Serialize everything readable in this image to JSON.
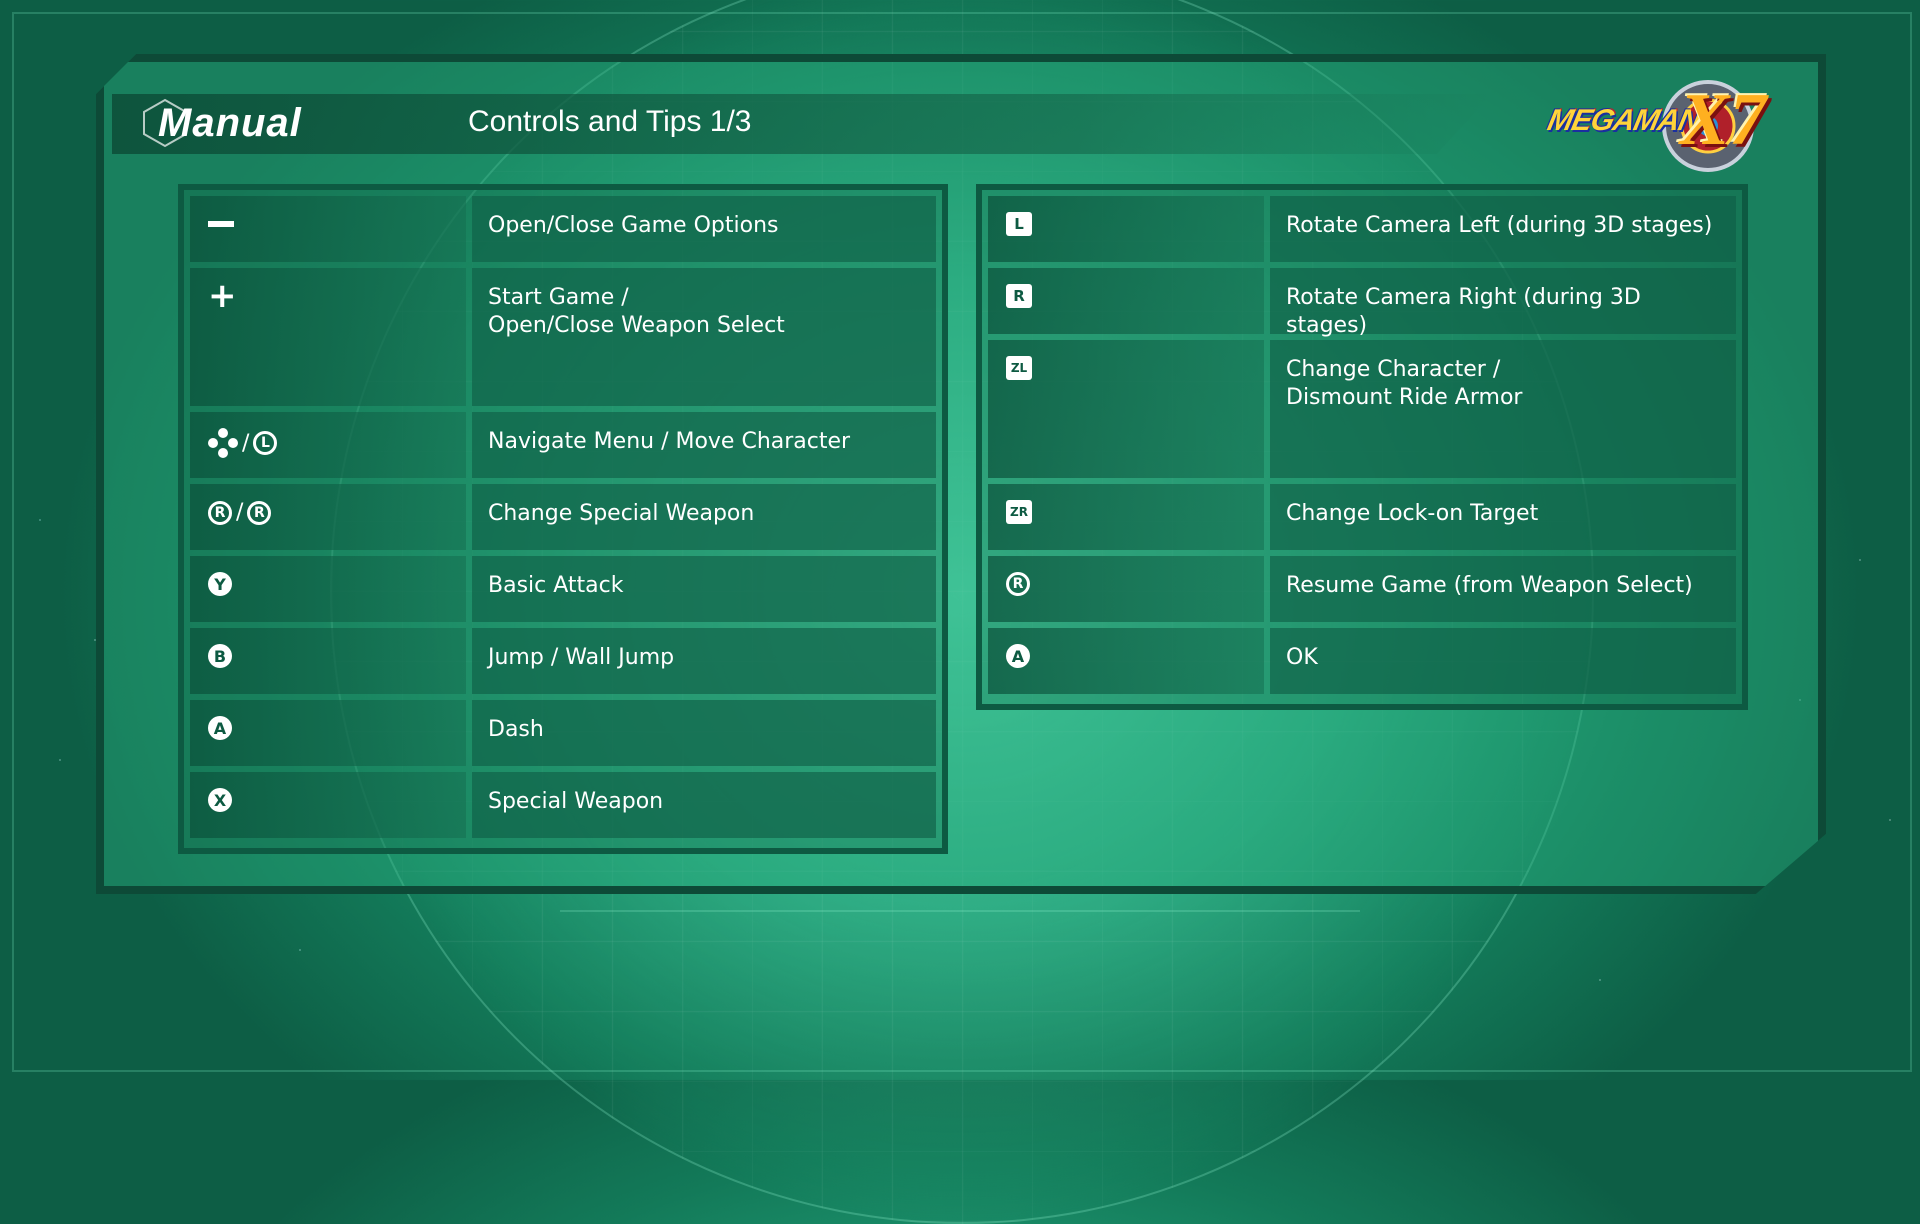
{
  "header": {
    "section_title": "Manual",
    "page_title": "Controls and Tips 1/3",
    "logo_text": "MEGAMAN",
    "logo_number": "X7"
  },
  "left_controls": [
    {
      "icons": [
        "minus-icon"
      ],
      "description": "Open/Close Game Options"
    },
    {
      "icons": [
        "plus-icon"
      ],
      "description": "Start Game /\nOpen/Close Weapon Select"
    },
    {
      "icons": [
        "dpad-icon",
        "left-stick-icon"
      ],
      "icon_labels": [
        "",
        "L"
      ],
      "separator": "/",
      "description": "Navigate Menu / Move Character"
    },
    {
      "icons": [
        "right-stick-left-icon",
        "right-stick-right-icon"
      ],
      "icon_labels": [
        "R",
        "R"
      ],
      "separator": "/",
      "description": "Change Special Weapon"
    },
    {
      "icons": [
        "y-button-icon"
      ],
      "icon_labels": [
        "Y"
      ],
      "description": "Basic Attack"
    },
    {
      "icons": [
        "b-button-icon"
      ],
      "icon_labels": [
        "B"
      ],
      "description": "Jump / Wall Jump"
    },
    {
      "icons": [
        "a-button-icon"
      ],
      "icon_labels": [
        "A"
      ],
      "description": "Dash"
    },
    {
      "icons": [
        "x-button-icon"
      ],
      "icon_labels": [
        "X"
      ],
      "description": "Special Weapon"
    }
  ],
  "right_controls": [
    {
      "icons": [
        "l-button-icon"
      ],
      "icon_labels": [
        "L"
      ],
      "description": "Rotate Camera Left (during 3D stages)"
    },
    {
      "icons": [
        "r-button-icon"
      ],
      "icon_labels": [
        "R"
      ],
      "description": "Rotate Camera Right (during 3D stages)"
    },
    {
      "icons": [
        "zl-button-icon"
      ],
      "icon_labels": [
        "ZL"
      ],
      "description": "Change Character /\nDismount Ride Armor"
    },
    {
      "icons": [
        "zr-button-icon"
      ],
      "icon_labels": [
        "ZR"
      ],
      "description": "Change Lock-on Target"
    },
    {
      "icons": [
        "right-stick-press-icon"
      ],
      "icon_labels": [
        "R"
      ],
      "description": "Resume Game (from Weapon Select)"
    },
    {
      "icons": [
        "a-button-icon"
      ],
      "icon_labels": [
        "A"
      ],
      "description": "OK"
    }
  ],
  "colors": {
    "background": "#23a37a",
    "panel_border": "#0d4a37",
    "cell_dark": "#0f5f46",
    "text": "#ffffff"
  }
}
